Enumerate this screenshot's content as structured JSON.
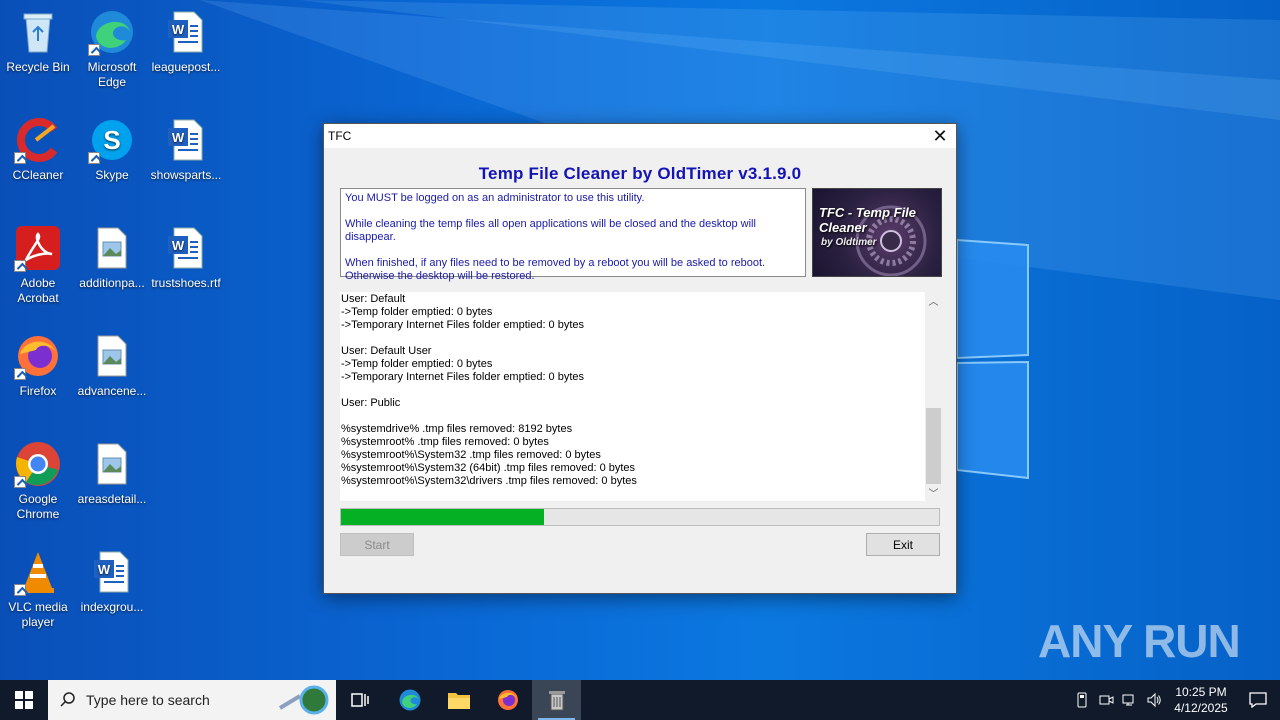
{
  "desktop": {
    "icons": [
      {
        "label": "Recycle Bin"
      },
      {
        "label": "Microsoft Edge"
      },
      {
        "label": "leaguepost..."
      },
      {
        "label": "CCleaner"
      },
      {
        "label": "Skype"
      },
      {
        "label": "showsparts..."
      },
      {
        "label": "Adobe Acrobat"
      },
      {
        "label": "additionpa..."
      },
      {
        "label": "trustshoes.rtf"
      },
      {
        "label": "Firefox"
      },
      {
        "label": "advancene..."
      },
      {
        "label": "Google Chrome"
      },
      {
        "label": "areasdetail..."
      },
      {
        "label": "VLC media player"
      },
      {
        "label": "indexgrou..."
      }
    ]
  },
  "window": {
    "title": "TFC",
    "app_title": "Temp File Cleaner by OldTimer v3.1.9.0",
    "info": {
      "line1": "You MUST be logged on as an administrator to use this utility.",
      "line2": "While cleaning the temp files all open applications will be closed and the desktop will disappear.",
      "line3": "When finished, if any files need to be removed by a reboot you will be asked to reboot.",
      "line4": "Otherwise the desktop will be restored."
    },
    "logo": {
      "title": "TFC - Temp File Cleaner",
      "subtitle": "by Oldtimer"
    },
    "log_lines": [
      "User: Default",
      "->Temp folder emptied: 0 bytes",
      "->Temporary Internet Files folder emptied: 0 bytes",
      "",
      "User: Default User",
      "->Temp folder emptied: 0 bytes",
      "->Temporary Internet Files folder emptied: 0 bytes",
      "",
      "User: Public",
      "",
      "%systemdrive% .tmp files removed: 8192 bytes",
      "%systemroot% .tmp files removed: 0 bytes",
      "%systemroot%\\System32 .tmp files removed: 0 bytes",
      "%systemroot%\\System32 (64bit) .tmp files removed: 0 bytes",
      "%systemroot%\\System32\\drivers .tmp files removed: 0 bytes"
    ],
    "progress_fraction": 0.34,
    "start_label": "Start",
    "exit_label": "Exit"
  },
  "watermark": "ANY RUN",
  "taskbar": {
    "search_placeholder": "Type here to search",
    "time": "10:25 PM",
    "date": "4/12/2025"
  },
  "colors": {
    "title_blue": "#1414b4",
    "progress_green": "#06b025"
  }
}
